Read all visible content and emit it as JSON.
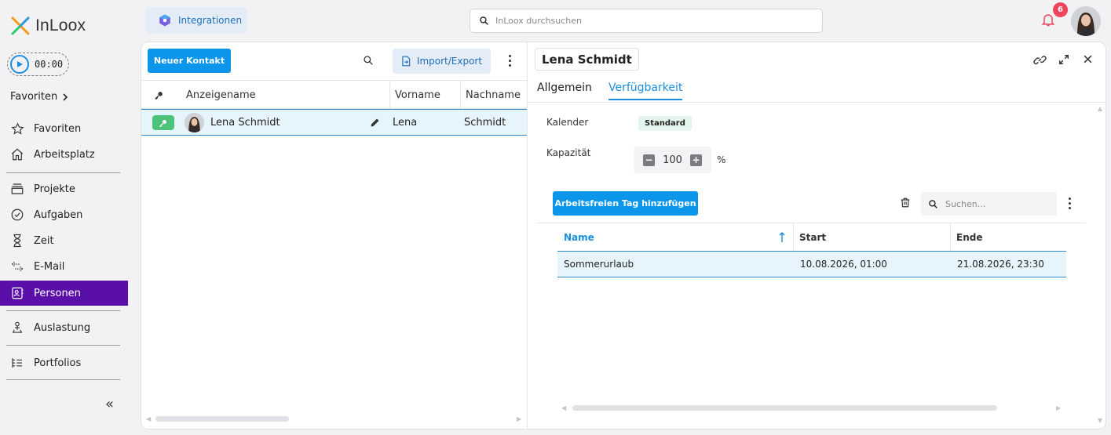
{
  "app": {
    "logo_text": "InLoox",
    "timer": "00:00",
    "favorites_header": "Favoriten",
    "colors": {
      "accent": "#0b95eb",
      "nav_active": "#5a0fa8",
      "badge": "#f0445a",
      "key_badge": "#4cc27a"
    }
  },
  "sidebar": {
    "items": [
      {
        "label": "Favoriten",
        "icon": "star-icon"
      },
      {
        "label": "Arbeitsplatz",
        "icon": "home-icon"
      },
      {
        "label": "Projekte",
        "icon": "projects-icon"
      },
      {
        "label": "Aufgaben",
        "icon": "check-circle-icon"
      },
      {
        "label": "Zeit",
        "icon": "hourglass-icon"
      },
      {
        "label": "E-Mail",
        "icon": "email-icon"
      },
      {
        "label": "Personen",
        "icon": "person-card-icon"
      },
      {
        "label": "Auslastung",
        "icon": "workload-icon"
      },
      {
        "label": "Portfolios",
        "icon": "portfolio-icon"
      }
    ],
    "collapse_glyph": "«"
  },
  "topbar": {
    "integrations_label": "Integrationen",
    "search_placeholder": "InLoox durchsuchen",
    "notification_count": "6"
  },
  "contacts": {
    "new_button": "Neuer Kontakt",
    "import_export": "Import/Export",
    "columns": {
      "display_name": "Anzeigename",
      "first_name": "Vorname",
      "last_name": "Nachname"
    },
    "rows": [
      {
        "display_name": "Lena Schmidt",
        "first_name": "Lena",
        "last_name": "Schmidt"
      }
    ]
  },
  "detail": {
    "title": "Lena Schmidt",
    "tabs": {
      "general": "Allgemein",
      "availability": "Verfügbarkeit"
    },
    "calendar_label": "Kalender",
    "calendar_value": "Standard",
    "capacity_label": "Kapazität",
    "capacity_value": "100",
    "capacity_unit": "%",
    "add_holiday_button": "Arbeitsfreien Tag hinzufügen",
    "search_placeholder": "Suchen...",
    "columns": {
      "name": "Name",
      "start": "Start",
      "end": "Ende"
    },
    "rows": [
      {
        "name": "Sommerurlaub",
        "start": "10.08.2026, 01:00",
        "end": "21.08.2026, 23:30"
      }
    ]
  }
}
